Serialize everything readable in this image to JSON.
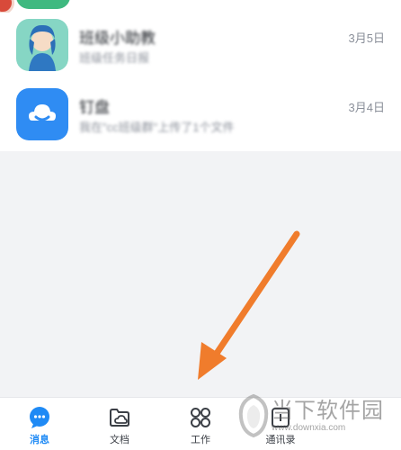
{
  "messages": [
    {
      "title": "班级小助教",
      "subtitle": "班级任务日报",
      "date": "3月5日",
      "avatar_icon": "teacher-avatar-icon"
    },
    {
      "title": "钉盘",
      "subtitle": "我在\"cc班级群\"上传了1个文件",
      "date": "3月4日",
      "avatar_icon": "cloud-drive-icon"
    }
  ],
  "tabbar": {
    "items": [
      {
        "label": "消息",
        "icon": "chat-bubble-icon",
        "active": true
      },
      {
        "label": "文档",
        "icon": "folder-cloud-icon",
        "active": false
      },
      {
        "label": "工作",
        "icon": "grid-apps-icon",
        "active": false
      },
      {
        "label": "通讯录",
        "icon": "contacts-icon",
        "active": false
      }
    ]
  },
  "watermark": {
    "title": "当下软件园",
    "url": "www.downxia.com"
  },
  "colors": {
    "accent": "#1f8af5",
    "arrow": "#f07c2c",
    "background": "#f2f3f5"
  }
}
